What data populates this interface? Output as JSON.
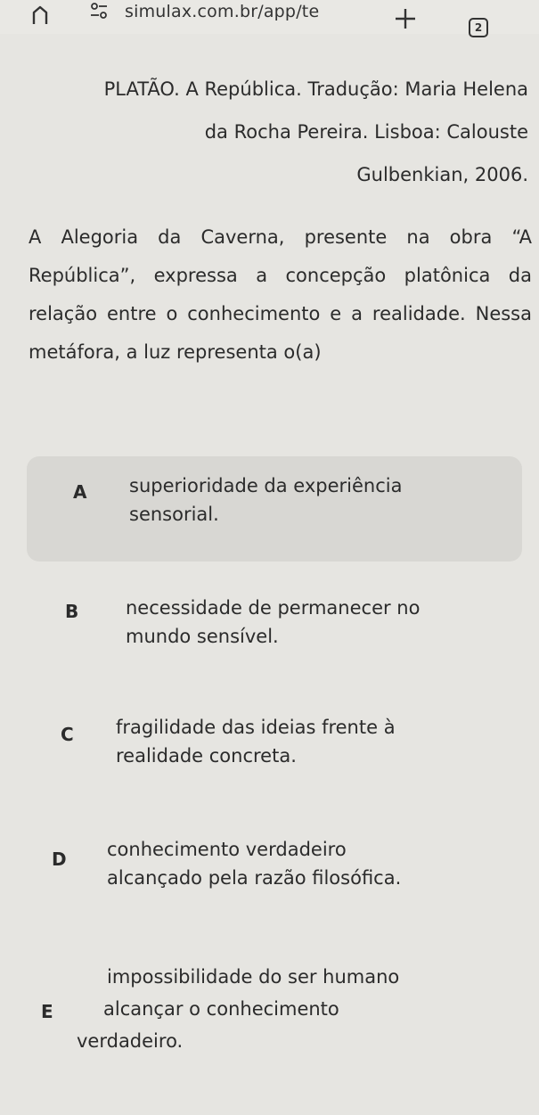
{
  "browser": {
    "url": "simulax.com.br/app/te",
    "tab_count": "2"
  },
  "citation": {
    "lines": [
      "PLATÃO. A República. Tradução: Maria Helena",
      "da Rocha Pereira. Lisboa: Calouste",
      "Gulbenkian, 2006."
    ]
  },
  "question": {
    "statement": "A Alegoria da Caverna, presente na obra “A República”, expressa a concepção platônica da relação entre o conhecimento e a realidade. Nessa metáfora, a luz representa o(a)"
  },
  "options": [
    {
      "letter": "A",
      "lines": [
        "superioridade da experiência",
        "sensorial."
      ]
    },
    {
      "letter": "B",
      "lines": [
        "necessidade de permanecer no",
        "mundo sensível."
      ]
    },
    {
      "letter": "C",
      "lines": [
        "fragilidade das ideias frente à",
        "realidade concreta."
      ]
    },
    {
      "letter": "D",
      "lines": [
        "conhecimento verdadeiro",
        "alcançado pela razão filosófica."
      ]
    },
    {
      "letter": "E",
      "lines": [
        "impossibilidade do ser humano",
        "alcançar o conhecimento",
        "verdadeiro."
      ]
    }
  ],
  "selected_option": "A"
}
